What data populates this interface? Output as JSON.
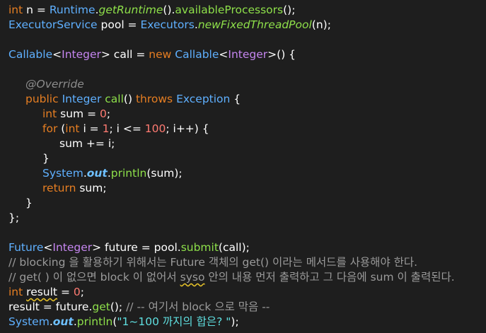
{
  "colors": {
    "background": "#1e1e1e",
    "keyword": "#e67e22",
    "type": "#5fb0ff",
    "generic": "#c586f0",
    "number": "#ff7b72",
    "method": "#8ee04a",
    "comment": "#9a9a9a",
    "string": "#5fdfe0"
  },
  "code": {
    "l1": {
      "kw": "int",
      "rest": " n = ",
      "cls": "Runtime",
      "dot": ".",
      "m": "getRuntime",
      "tail1": "().",
      "m2": "availableProcessors",
      "tail2": "();"
    },
    "l2": {
      "cls": "ExecutorService",
      "var": " pool = ",
      "cls2": "Executors",
      "dot": ".",
      "m": "newFixedThreadPool",
      "tail": "(n);"
    },
    "l4": {
      "cls": "Callable",
      "lt": "<",
      "gen": "Integer",
      "gt": "> call = ",
      "kw": "new",
      "sp": " ",
      "cls2": "Callable",
      "lt2": "<",
      "gen2": "Integer",
      "tail": ">() {"
    },
    "l6": {
      "ann": "@Override"
    },
    "l7": {
      "kw": "public",
      "sp": " ",
      "type": "Integer",
      "sp2": " ",
      "m": "call",
      "paren": "() ",
      "kw2": "throws",
      "sp3": " ",
      "type2": "Exception",
      "tail": " {"
    },
    "l8": {
      "kw": "int",
      "rest": " sum = ",
      "num": "0",
      "tail": ";"
    },
    "l9": {
      "kw": "for",
      "p1": " (",
      "kw2": "int",
      "p2": " i = ",
      "n1": "1",
      "p3": "; i <= ",
      "n2": "100",
      "tail": "; i++) {"
    },
    "l10": {
      "text": "sum += i;"
    },
    "l11": {
      "text": "}"
    },
    "l12": {
      "cls": "System",
      "dot": ".",
      "fld": "out",
      "dot2": ".",
      "m": "println",
      "tail": "(sum);"
    },
    "l13": {
      "kw": "return",
      "tail": " sum;"
    },
    "l14": {
      "text": "}"
    },
    "l15": {
      "text": "};"
    },
    "l17": {
      "cls": "Future",
      "lt": "<",
      "gen": "Integer",
      "gt": "> future = pool.",
      "m": "submit",
      "tail": "(call);"
    },
    "l18": {
      "cmt": "// blocking 을 활용하기 위해서는 Future 객체의 get() 이라는 메서드를 사용해야 한다."
    },
    "l19": {
      "cmt1": "// get( ) 이 없으면 block 이 없어서 ",
      "sysout": "syso",
      "cmt2": " 안의 내용 먼저 출력하고 그 다음에 sum 이 출력된다."
    },
    "l20": {
      "kw": "int",
      "sp": " ",
      "var": "result",
      "rest": " = ",
      "num": "0",
      "tail": ";"
    },
    "l21": {
      "pre": "result = future.",
      "m": "get",
      "mid": "(); ",
      "cmt": "// -- 여기서 block 으로 막음 --"
    },
    "l22": {
      "cls": "System",
      "dot": ".",
      "fld": "out",
      "dot2": ".",
      "m": "println",
      "p": "(",
      "str": "\"1~100 까지의 합은? \"",
      "tail": ");"
    }
  }
}
